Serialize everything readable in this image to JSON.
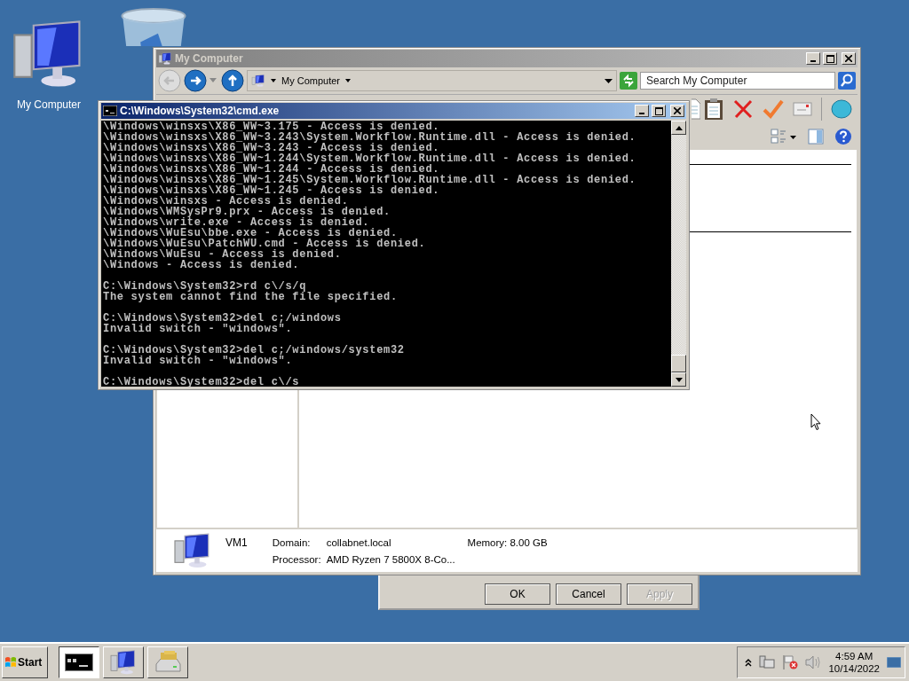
{
  "desktop_icons": [
    {
      "kind": "computer",
      "label": "My Computer"
    },
    {
      "kind": "recycle-bin"
    }
  ],
  "explorer": {
    "title": "My Computer",
    "address": "My Computer",
    "search": {
      "placeholder": "Search My Computer"
    },
    "details": {
      "name": "VM1",
      "domain_label": "Domain:",
      "domain": "collabnet.local",
      "memory_label": "Memory:",
      "memory": "8.00 GB",
      "processor_label": "Processor:",
      "processor": "AMD Ryzen 7 5800X 8-Co..."
    }
  },
  "dialog": {
    "buttons": [
      {
        "label": "OK",
        "disabled": false
      },
      {
        "label": "Cancel",
        "disabled": false
      },
      {
        "label": "Apply",
        "disabled": true
      }
    ]
  },
  "console": {
    "title": "C:\\Windows\\System32\\cmd.exe",
    "blocks": [
      [
        "\\Windows\\winsxs\\X86_WW~3.175 - Access is denied.",
        "\\Windows\\winsxs\\X86_WW~3.243\\System.Workflow.Runtime.dll - Access is denied.",
        "\\Windows\\winsxs\\X86_WW~3.243 - Access is denied.",
        "\\Windows\\winsxs\\X86_WW~1.244\\System.Workflow.Runtime.dll - Access is denied.",
        "\\Windows\\winsxs\\X86_WW~1.244 - Access is denied.",
        "\\Windows\\winsxs\\X86_WW~1.245\\System.Workflow.Runtime.dll - Access is denied.",
        "\\Windows\\winsxs\\X86_WW~1.245 - Access is denied.",
        "\\Windows\\winsxs - Access is denied.",
        "\\Windows\\WMSysPr9.prx - Access is denied.",
        "\\Windows\\write.exe - Access is denied.",
        "\\Windows\\WuEsu\\bbe.exe - Access is denied.",
        "\\Windows\\WuEsu\\PatchWU.cmd - Access is denied.",
        "\\Windows\\WuEsu - Access is denied.",
        "\\Windows - Access is denied."
      ],
      [
        "C:\\Windows\\System32>rd c\\/s/q",
        "The system cannot find the file specified."
      ],
      [
        "C:\\Windows\\System32>del c;/windows",
        "Invalid switch - \"windows\"."
      ],
      [
        "C:\\Windows\\System32>del c;/windows/system32",
        "Invalid switch - \"windows\"."
      ],
      [
        "C:\\Windows\\System32>del c\\/s"
      ]
    ]
  },
  "taskbar": {
    "start": "Start",
    "buttons": [
      {
        "kind": "console",
        "selected": true
      },
      {
        "kind": "computer",
        "selected": false
      },
      {
        "kind": "drive",
        "selected": false
      }
    ],
    "clock": {
      "time": "4:59 AM",
      "date": "10/14/2022"
    }
  }
}
